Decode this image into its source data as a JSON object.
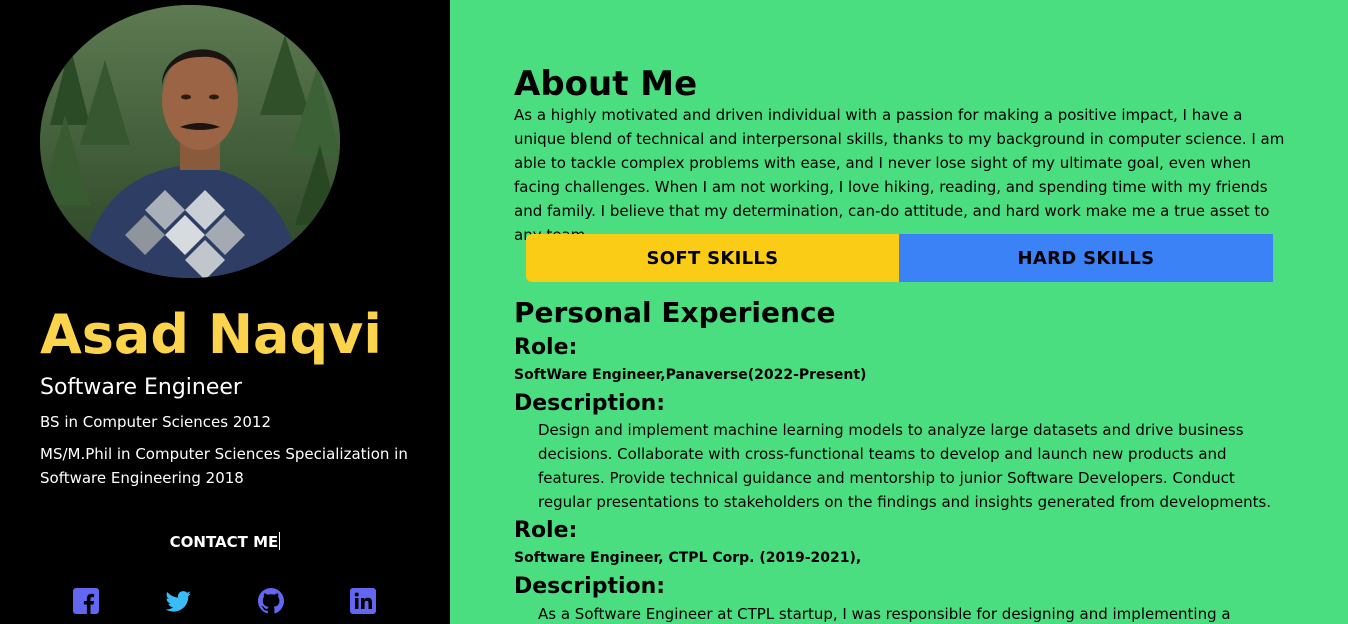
{
  "profile": {
    "avatar_alt": "profile-photo",
    "name": "Asad Naqvi",
    "job_title": "Software Engineer",
    "education": [
      "BS in Computer Sciences 2012",
      "MS/M.Phil in Computer Sciences Specialization in Software Engineering 2018"
    ],
    "contact_label": "CONTACT ME",
    "social": [
      {
        "icon": "facebook-icon",
        "color": "#6366f1"
      },
      {
        "icon": "twitter-icon",
        "color": "#38bdf8"
      },
      {
        "icon": "github-icon",
        "color": "#6366f1"
      },
      {
        "icon": "linkedin-icon",
        "color": "#6366f1"
      }
    ]
  },
  "about": {
    "heading": "About Me",
    "text": "As a highly motivated and driven individual with a passion for making a positive impact, I have a unique blend of technical and interpersonal skills, thanks to my background in computer science. I am able to tackle complex problems with ease, and I never lose sight of my ultimate goal, even when facing challenges. When I am not working, I love hiking, reading, and spending time with my friends and family. I believe that my determination, can-do attitude, and hard work make me a true asset to any team."
  },
  "skills": {
    "soft_label": "SOFT SKILLS",
    "hard_label": "HARD SKILLS",
    "soft_color": "#facc15",
    "hard_color": "#3b82f6"
  },
  "experience": {
    "heading": "Personal Experience",
    "role_label": "Role:",
    "description_label": "Description:",
    "items": [
      {
        "role": "SoftWare Engineer,Panaverse(2022-Present)",
        "description": "Design and implement machine learning models to analyze large datasets and drive business decisions. Collaborate with cross-functional teams to develop and launch new products and features. Provide technical guidance and mentorship to junior Software Developers. Conduct regular presentations to stakeholders on the findings and insights generated from developments."
      },
      {
        "role": "Software Engineer, CTPL Corp. (2019-2021),",
        "description": "As a Software Engineer at CTPL startup, I was responsible for designing and implementing a scalable"
      }
    ]
  },
  "colors": {
    "sidebar_bg": "#000000",
    "main_bg": "#4ade80",
    "name_color": "#fcd34d"
  }
}
